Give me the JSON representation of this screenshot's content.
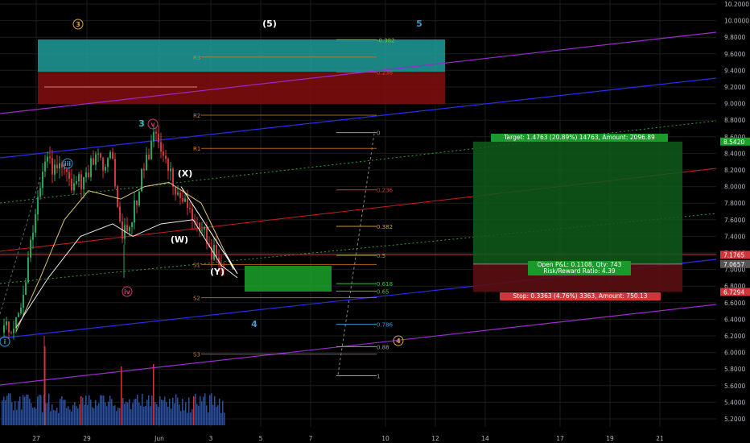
{
  "colors": {
    "background": "#000000",
    "grid": "#1c1c1c",
    "axis_text": "#b2b5be",
    "teal_box": "#1e9c9a",
    "red_box": "#7d0d0d",
    "green_zone": "#1aa329",
    "target_box": "#0f5a1a",
    "stop_box": "#5a0e12",
    "channel_blue": "#2a2af0",
    "channel_red": "#d01a1a",
    "channel_purple": "#9a2ad0",
    "channel_green_dotted": "#2aa33a",
    "fib_orange": "#cc7a1a",
    "fib_gray": "#9a9a9a",
    "pivot_orange": "#d97a1a",
    "candle_up": "#26a65b",
    "candle_down": "#d0353a",
    "ma_yellow": "#d9c470",
    "ma_white": "#e8e8e8"
  },
  "icons": {
    "circled_label": "circle-outline",
    "price_tag": "rect-tag"
  },
  "chart_data": {
    "type": "candlestick",
    "y_axis_labels": [
      "10.2000",
      "10.0000",
      "9.8000",
      "9.6000",
      "9.4000",
      "9.2000",
      "9.0000",
      "8.8000",
      "8.6000",
      "8.4000",
      "8.2000",
      "8.0000",
      "7.8000",
      "7.6000",
      "7.4000",
      "7.2000",
      "7.0000",
      "6.8000",
      "6.6000",
      "6.4000",
      "6.2000",
      "6.0000",
      "5.8000",
      "5.6000",
      "5.4000",
      "5.2000"
    ],
    "x_axis_labels": [
      "27",
      "27",
      "29",
      "Jun",
      "3",
      "5",
      "7",
      "10",
      "12",
      "14",
      "17",
      "19",
      "21"
    ],
    "ylim": [
      5.1,
      10.25
    ],
    "price_tags": [
      {
        "label": "8.5420",
        "value": 8.542,
        "color": "#1aa329"
      },
      {
        "label": "7.1765",
        "value": 7.1765,
        "color": "#d0353a"
      },
      {
        "label": "7.0657",
        "value": 7.0657,
        "color": "#555555"
      },
      {
        "label": "6.7294",
        "value": 6.7294,
        "color": "#d0353a"
      }
    ],
    "fib_levels": [
      {
        "label": "-0.382",
        "value": 9.77,
        "color": "#7ac03a"
      },
      {
        "label": "0.236",
        "value": 9.38,
        "color": "#cc3a3a"
      },
      {
        "label": "0",
        "value": 8.65,
        "color": "#9a9a9a"
      },
      {
        "label": "0.236",
        "value": 7.96,
        "color": "#cc3a3a"
      },
      {
        "label": "0.382",
        "value": 7.52,
        "color": "#cc9a3a"
      },
      {
        "label": "0.5",
        "value": 7.17,
        "color": "#3ac03a"
      },
      {
        "label": "0.618",
        "value": 6.83,
        "color": "#3ac03a"
      },
      {
        "label": "0.65",
        "value": 6.74,
        "color": "#3ac03a"
      },
      {
        "label": "0.786",
        "value": 6.34,
        "color": "#3a9acc"
      },
      {
        "label": "0.88",
        "value": 6.07,
        "color": "#9a9a9a"
      },
      {
        "label": "1",
        "value": 5.72,
        "color": "#9a9a9a"
      }
    ],
    "pivots": [
      {
        "label": "R3",
        "value": 9.56
      },
      {
        "label": "R2",
        "value": 8.86
      },
      {
        "label": "R1",
        "value": 8.46
      },
      {
        "label": "S1",
        "value": 7.06
      },
      {
        "label": "S2",
        "value": 6.66
      },
      {
        "label": "S3",
        "value": 5.98
      }
    ],
    "wave_labels": [
      {
        "text": "3",
        "kind": "circle",
        "x": "24 May",
        "y": 9.95,
        "color": "#d9a43a"
      },
      {
        "text": "(5)",
        "kind": "plain",
        "x": "4 Jun",
        "y": 9.95,
        "color": "#ffffff"
      },
      {
        "text": "5",
        "kind": "plain",
        "x": "10.5 Jun",
        "y": 9.95,
        "color": "#3a9acc"
      },
      {
        "text": "3",
        "kind": "plain",
        "x": "30 May",
        "y": 8.7,
        "color": "#3ac0c0"
      },
      {
        "text": "v",
        "kind": "circle",
        "x": "31 May",
        "y": 8.7,
        "color": "#cc3a6a"
      },
      {
        "text": "4",
        "kind": "plain",
        "x": "4 Jun",
        "y": 6.32,
        "color": "#3a9acc"
      },
      {
        "text": "4",
        "kind": "circle",
        "x": "10.5 Jun",
        "y": 6.1,
        "color": "#d9a43a"
      },
      {
        "text": "iv",
        "kind": "circle",
        "x": "29 May",
        "y": 6.85,
        "color": "#cc3a6a"
      },
      {
        "text": "i",
        "kind": "circle",
        "x": "26 May",
        "y": 6.1,
        "color": "#3a9acc"
      },
      {
        "text": "iii",
        "kind": "circle",
        "x": "27.5 May",
        "y": 8.3,
        "color": "#3a9acc"
      },
      {
        "text": "(X)",
        "kind": "plain",
        "x": "2 Jun",
        "y": 8.1,
        "color": "#ffffff"
      },
      {
        "text": "(W)",
        "kind": "plain",
        "x": "1.5 Jun",
        "y": 7.35,
        "color": "#ffffff"
      },
      {
        "text": "(Y)",
        "kind": "plain",
        "x": "3 Jun",
        "y": 6.96,
        "color": "#ffffff"
      }
    ],
    "trade": {
      "target_label": "Target: 1.4763 (20.89%) 14763, Amount: 2096.89",
      "pnl_label": "Open P&L: 0.1108, Qty: 743",
      "rr_label": "Risk/Reward Ratio: 4.39",
      "stop_label": "Stop: 0.3363 (4.76%) 3363, Amount: 750.13",
      "entry": 7.0657,
      "target": 8.542,
      "stop": 6.7294
    }
  }
}
